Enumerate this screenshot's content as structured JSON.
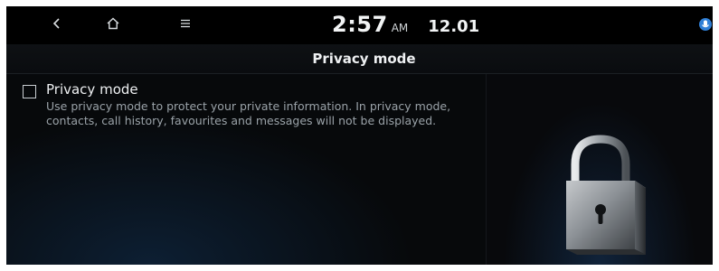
{
  "status_bar": {
    "back_icon": "chevron-left-icon",
    "home_icon": "home-icon",
    "menu_icon": "menu-icon",
    "time": "2:57",
    "ampm": "AM",
    "date": "12.01",
    "status_icon": "voice-assistant-icon"
  },
  "header": {
    "title": "Privacy mode"
  },
  "privacy_option": {
    "checked": false,
    "label": "Privacy mode",
    "description": "Use privacy mode to protect your private information. In privacy mode, contacts, call history, favourites and messages will not be displayed."
  },
  "illustration": {
    "icon": "padlock-icon"
  },
  "colors": {
    "background": "#07090b",
    "text_primary": "#eef0f2",
    "text_secondary": "#9aa2a8",
    "accent_blue": "#10233a"
  }
}
